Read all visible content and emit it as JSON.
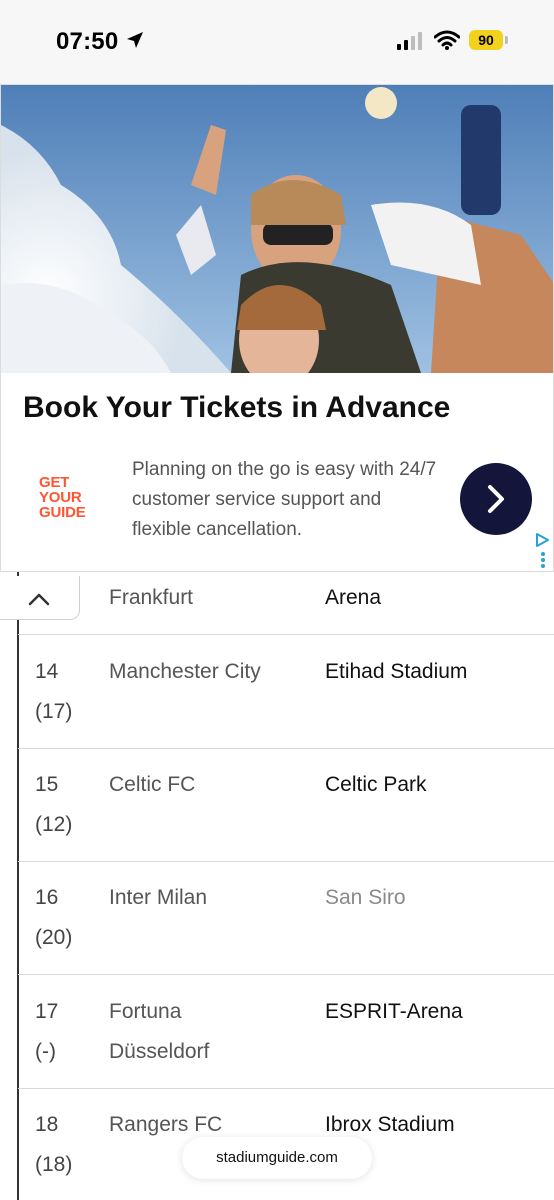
{
  "status_bar": {
    "time": "07:50",
    "battery_level": "90",
    "battery_color": "#f3d21f",
    "icons": [
      "location-arrow-icon",
      "cellular-signal-icon",
      "wifi-icon",
      "battery-icon"
    ]
  },
  "ad": {
    "title": "Book Your Tickets in Advance",
    "logo_lines": [
      "GET",
      "YOUR",
      "GUIDE"
    ],
    "body": "Planning on the go is easy with 24/7 customer service support and flexible cancellation.",
    "brand_color": "#ff5533",
    "button_color": "#13163a",
    "icons": [
      "chevron-right-icon",
      "adchoices-icon",
      "vertical-dots-icon"
    ]
  },
  "table": {
    "partial_row": {
      "team": "Frankfurt",
      "stadium": "Arena"
    },
    "rows": [
      {
        "rank": "14",
        "prev": "(17)",
        "team": "Manchester City",
        "team2": "",
        "stadium": "Etihad Stadium"
      },
      {
        "rank": "15",
        "prev": "(12)",
        "team": "Celtic FC",
        "team2": "",
        "stadium": "Celtic Park"
      },
      {
        "rank": "16",
        "prev": "(20)",
        "team": "Inter Milan",
        "team2": "",
        "stadium": "San Siro"
      },
      {
        "rank": "17",
        "prev": "(-)",
        "team": "Fortuna",
        "team2": "Düsseldorf",
        "stadium": "ESPRIT-Arena"
      },
      {
        "rank": "18",
        "prev": "(18)",
        "team": "Rangers FC",
        "team2": "",
        "stadium": "Ibrox Stadium"
      }
    ]
  },
  "site_url": "stadiumguide.com"
}
